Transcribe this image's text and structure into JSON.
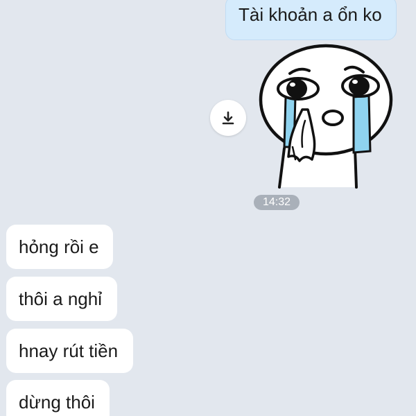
{
  "messages": {
    "outgoing_text": "Tài khoản a ổn ko",
    "sticker": {
      "icon": "crying-face-sticker-icon",
      "download_icon": "download-icon"
    },
    "time": "14:32",
    "incoming": [
      {
        "text": "hỏng rồi e"
      },
      {
        "text": "thôi a nghỉ"
      },
      {
        "text": "hnay rút tiền"
      },
      {
        "text": "dừng thôi"
      }
    ]
  },
  "colors": {
    "background": "#e2e7ee",
    "outgoing_bubble": "#d5ebfc",
    "incoming_bubble": "#ffffff",
    "time_pill": "#a9b0b9",
    "tear": "#8fd3ef"
  }
}
